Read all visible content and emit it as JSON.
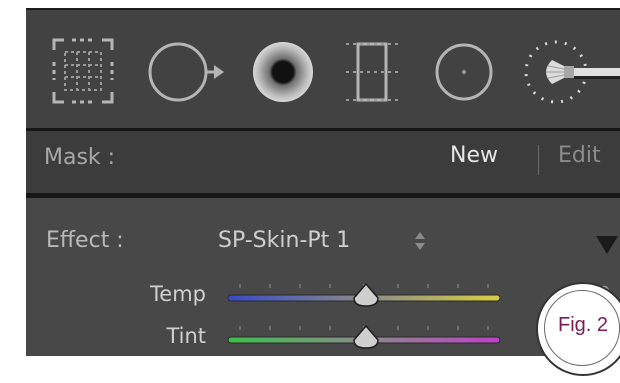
{
  "toolbar": {
    "tools": [
      {
        "icon": "crop-overlay-icon"
      },
      {
        "icon": "spot-removal-icon"
      },
      {
        "icon": "red-eye-icon"
      },
      {
        "icon": "graduated-filter-icon"
      },
      {
        "icon": "radial-filter-icon"
      },
      {
        "icon": "adjustment-brush-icon"
      }
    ]
  },
  "mask": {
    "label": "Mask :",
    "new_label": "New",
    "edit_label": "Edit"
  },
  "effect": {
    "label": "Effect :",
    "value": "SP-Skin-Pt 1"
  },
  "sliders": [
    {
      "label": "Temp",
      "value": "0",
      "position": 0.51
    },
    {
      "label": "Tint",
      "value": "0",
      "position": 0.51
    }
  ],
  "badge": {
    "text": "Fig. 2"
  }
}
